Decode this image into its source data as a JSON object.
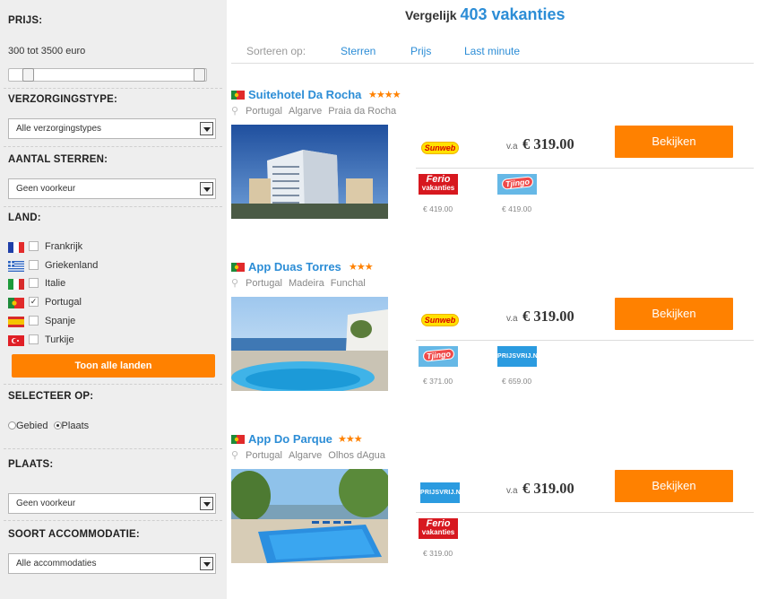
{
  "sidebar": {
    "price": {
      "title": "PRIJS:",
      "range_label": "300 tot 3500 euro"
    },
    "care_type": {
      "title": "VERZORGINGSTYPE:",
      "selected": "Alle verzorgingstypes"
    },
    "stars": {
      "title": "AANTAL STERREN:",
      "selected": "Geen voorkeur"
    },
    "country": {
      "title": "LAND:",
      "items": [
        {
          "label": "Frankrijk",
          "checked": false,
          "flag": "flag-france-icon"
        },
        {
          "label": "Griekenland",
          "checked": false,
          "flag": "flag-greece-icon"
        },
        {
          "label": "Italie",
          "checked": false,
          "flag": "flag-italy-icon"
        },
        {
          "label": "Portugal",
          "checked": true,
          "flag": "flag-portugal-icon"
        },
        {
          "label": "Spanje",
          "checked": false,
          "flag": "flag-spain-icon"
        },
        {
          "label": "Turkije",
          "checked": false,
          "flag": "flag-turkey-icon"
        }
      ],
      "show_all_button": "Toon alle landen"
    },
    "select_on": {
      "title": "SELECTEER OP:",
      "option_region": "Gebied",
      "option_place": "Plaats",
      "selected": "Plaats"
    },
    "place": {
      "title": "PLAATS:",
      "selected": "Geen voorkeur"
    },
    "accommodation": {
      "title": "SOORT ACCOMMODATIE:",
      "selected": "Alle accommodaties"
    }
  },
  "main": {
    "title_prefix": "Vergelijk",
    "title_count": "403 vakanties",
    "sort": {
      "label": "Sorteren op:",
      "options": [
        "Sterren",
        "Prijs",
        "Last minute"
      ]
    }
  },
  "hotels": [
    {
      "name": "Suitehotel Da Rocha",
      "stars": "★★★★",
      "location": [
        "Portugal",
        "Algarve",
        "Praia da Rocha"
      ],
      "va": "v.a",
      "price": "€ 319.00",
      "cta": "Bekijken",
      "best_provider": "Sunweb",
      "alternatives": [
        {
          "provider": "Ferio vakanties",
          "price": "€ 419.00"
        },
        {
          "provider": "Tjingo",
          "price": "€ 419.00"
        }
      ]
    },
    {
      "name": "App Duas Torres",
      "stars": "★★★",
      "location": [
        "Portugal",
        "Madeira",
        "Funchal"
      ],
      "va": "v.a",
      "price": "€ 319.00",
      "cta": "Bekijken",
      "best_provider": "Sunweb",
      "alternatives": [
        {
          "provider": "Tjingo",
          "price": "€ 371.00"
        },
        {
          "provider": "Prijsvrij",
          "price": "€ 659.00"
        }
      ]
    },
    {
      "name": "App Do Parque",
      "stars": "★★★",
      "location": [
        "Portugal",
        "Algarve",
        "Olhos dAgua"
      ],
      "va": "v.a",
      "price": "€ 319.00",
      "cta": "Bekijken",
      "best_provider": "Prijsvrij",
      "alternatives": [
        {
          "provider": "Ferio vakanties",
          "price": "€ 319.00"
        }
      ]
    }
  ],
  "logos": {
    "sunweb": "Sunweb",
    "ferio_a": "Ferio",
    "ferio_b": "vakanties",
    "tjingo": "Tjingo",
    "prijsvrij": "PRIJSVRIJ.NL"
  },
  "colors": {
    "accent_orange": "#ff8100",
    "link_blue": "#2c8dd6",
    "sidebar_bg": "#eeeeee"
  }
}
